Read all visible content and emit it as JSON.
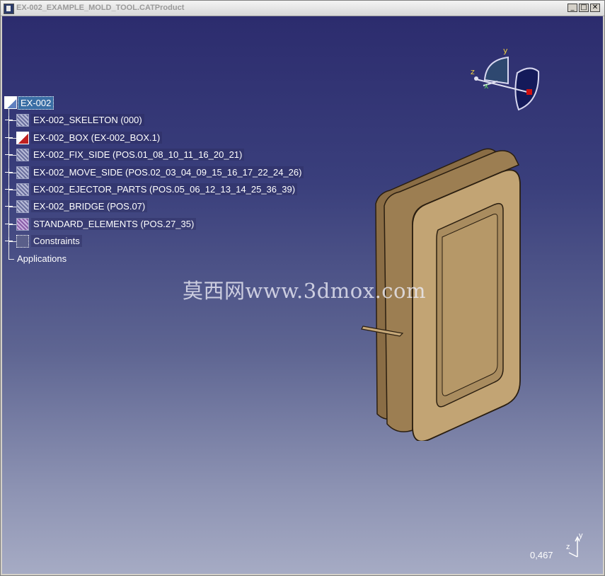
{
  "window": {
    "title": "EX-002_EXAMPLE_MOLD_TOOL.CATProduct",
    "controls": {
      "minimize": "_",
      "restore": "□",
      "close": "✕"
    }
  },
  "tree": {
    "root": {
      "label": "EX-002",
      "icon": "product-root-icon"
    },
    "items": [
      {
        "label": "EX-002_SKELETON (000)",
        "icon": "part-icon"
      },
      {
        "label": "EX-002_BOX (EX-002_BOX.1)",
        "icon": "product-icon"
      },
      {
        "label": "EX-002_FIX_SIDE (POS.01_08_10_11_16_20_21)",
        "icon": "part-icon"
      },
      {
        "label": "EX-002_MOVE_SIDE (POS.02_03_04_09_15_16_17_22_24_26)",
        "icon": "part-icon"
      },
      {
        "label": "EX-002_EJECTOR_PARTS (POS.05_06_12_13_14_25_36_39)",
        "icon": "part-icon"
      },
      {
        "label": "EX-002_BRIDGE (POS.07)",
        "icon": "part-icon"
      },
      {
        "label": "STANDARD_ELEMENTS (POS.27_35)",
        "icon": "standard-elements-icon"
      },
      {
        "label": "Constraints",
        "icon": "constraints-icon"
      }
    ],
    "applications": "Applications"
  },
  "compass": {
    "x": "x",
    "y": "y",
    "z": "z"
  },
  "watermark": "莫西网www.3dmox.com",
  "status": {
    "scale": "0,467",
    "mini_axes": {
      "y": "y",
      "z": "z"
    }
  },
  "colors": {
    "viewport_top": "#2c2c6e",
    "viewport_bottom": "#a6abc4",
    "part_fill": "#b99a6a",
    "selection": "#3a6ea5"
  }
}
